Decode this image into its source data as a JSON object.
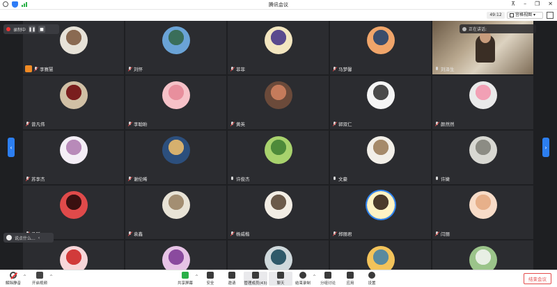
{
  "window": {
    "title": "腾讯会议"
  },
  "header": {
    "timer": "49:12",
    "view_label": "宫格视图"
  },
  "recording": {
    "label": "录制中"
  },
  "speaking": {
    "label": "正在讲话:"
  },
  "chat": {
    "preview": "说点什么..."
  },
  "participants": [
    {
      "name": "李赛慧",
      "muted": true,
      "host": true,
      "colors": [
        "#e7e2d8",
        "#8a6a52"
      ]
    },
    {
      "name": "刘怀",
      "muted": true,
      "colors": [
        "#6aa3d6",
        "#3a6e5a"
      ]
    },
    {
      "name": "菲菲",
      "muted": true,
      "colors": [
        "#f3e6c0",
        "#5a4a8e"
      ]
    },
    {
      "name": "马梦馨",
      "muted": true,
      "colors": [
        "#f0a56a",
        "#3b4d6b"
      ]
    },
    {
      "name": "刘泽生",
      "muted": false,
      "video": true,
      "colors": [
        "#b9a88f",
        "#6b5a46"
      ]
    },
    {
      "name": "曾凡伟",
      "muted": true,
      "colors": [
        "#d1c0a5",
        "#7a1e1e"
      ]
    },
    {
      "name": "李聪盼",
      "muted": true,
      "colors": [
        "#f6c2c8",
        "#e88f9d"
      ]
    },
    {
      "name": "黄英",
      "muted": true,
      "colors": [
        "#6b4a3a",
        "#c57b5b"
      ]
    },
    {
      "name": "郭双仁",
      "muted": true,
      "colors": [
        "#f5f5f5",
        "#4a4a4a"
      ]
    },
    {
      "name": "颜然然",
      "muted": true,
      "colors": [
        "#eaeaea",
        "#f2a0b5"
      ]
    },
    {
      "name": "苏李杰",
      "muted": true,
      "colors": [
        "#f4eef6",
        "#b88ab9"
      ]
    },
    {
      "name": "谢伦晞",
      "muted": true,
      "colors": [
        "#2c4f7d",
        "#d6b06e"
      ]
    },
    {
      "name": "许俊杰",
      "muted": false,
      "colors": [
        "#a8d26d",
        "#4e8a3a"
      ]
    },
    {
      "name": "文豪",
      "muted": false,
      "colors": [
        "#f2efe8",
        "#a58a6a"
      ]
    },
    {
      "name": "许婕",
      "muted": false,
      "colors": [
        "#d8d8d2",
        "#8c8c84"
      ]
    },
    {
      "name": "马跃",
      "muted": true,
      "colors": [
        "#e04a4a",
        "#3a1010"
      ]
    },
    {
      "name": "袁鑫",
      "muted": true,
      "colors": [
        "#e8e3d6",
        "#a38e72"
      ]
    },
    {
      "name": "杨威楷",
      "muted": true,
      "colors": [
        "#f2ede4",
        "#6b5a4a"
      ]
    },
    {
      "name": "郑丽君",
      "muted": true,
      "ring": true,
      "colors": [
        "#fff3c4",
        "#4a3a2a"
      ]
    },
    {
      "name": "闫丽",
      "muted": true,
      "colors": [
        "#f8dcc8",
        "#e7b08a"
      ]
    },
    {
      "name": "",
      "muted": true,
      "colors": [
        "#f7d6d9",
        "#d13a3a"
      ]
    },
    {
      "name": "",
      "muted": true,
      "colors": [
        "#e7c3e6",
        "#8a4a9e"
      ]
    },
    {
      "name": "",
      "muted": true,
      "colors": [
        "#cfd9dc",
        "#2f5a6a"
      ]
    },
    {
      "name": "",
      "muted": true,
      "colors": [
        "#f3c35a",
        "#5a8a9e"
      ]
    },
    {
      "name": "",
      "muted": true,
      "colors": [
        "#9bc48a",
        "#e8efe4"
      ]
    }
  ],
  "toolbar": {
    "unmute": "解除静音",
    "video": "开启视频",
    "share": "共享屏幕",
    "security": "安全",
    "invite": "邀请",
    "members": "管理成员(43)",
    "chat": "聊天",
    "record": "结束录制",
    "breakout": "分组讨论",
    "apps": "应用",
    "settings": "设置",
    "end": "结束会议"
  }
}
